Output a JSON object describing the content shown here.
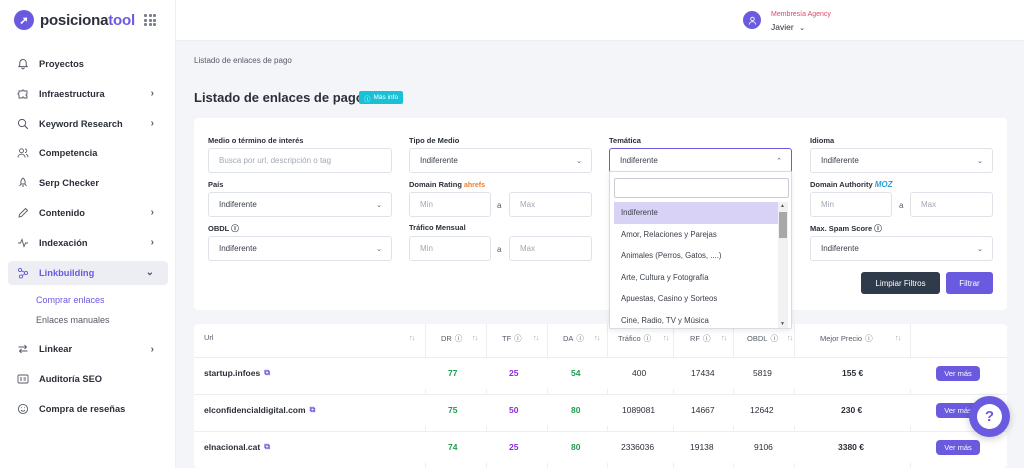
{
  "brand": {
    "name_prefix": "posiciona",
    "name_suffix": "tool",
    "accent": "#6a5ae0"
  },
  "user": {
    "role": "Membresía Agency",
    "name": "Javier"
  },
  "sidebar": {
    "items": [
      {
        "label": "Proyectos",
        "icon": "bell-icon"
      },
      {
        "label": "Infraestructura",
        "icon": "puzzle-icon"
      },
      {
        "label": "Keyword Research",
        "icon": "search-icon"
      },
      {
        "label": "Competencia",
        "icon": "users-icon"
      },
      {
        "label": "Serp Checker",
        "icon": "rocket-icon"
      },
      {
        "label": "Contenido",
        "icon": "pencil-icon"
      },
      {
        "label": "Indexación",
        "icon": "pulse-icon"
      },
      {
        "label": "Linkbuilding",
        "icon": "links-icon"
      },
      {
        "label": "Linkear",
        "icon": "arrows-icon"
      },
      {
        "label": "Auditoría SEO",
        "icon": "audit-icon"
      },
      {
        "label": "Compra de reseñas",
        "icon": "smile-icon"
      }
    ],
    "sub_items": [
      "Comprar enlaces",
      "Enlaces manuales"
    ]
  },
  "breadcrumb": "Listado de enlaces de pago",
  "page": {
    "title": "Listado de enlaces de pago",
    "info_badge": "Más info"
  },
  "filters": {
    "medio_label": "Medio o término de interés",
    "medio_placeholder": "Busca por url, descripción o tag",
    "tipo_label": "Tipo de Medio",
    "tipo_value": "Indiferente",
    "tematica_label": "Temática",
    "tematica_value": "Indiferente",
    "idioma_label": "Idioma",
    "idioma_value": "Indiferente",
    "pais_label": "País",
    "pais_value": "Indiferente",
    "dr_label": "Domain Rating",
    "dr_brand": "ahrefs",
    "da_label": "Domain Authority",
    "da_brand": "MOZ",
    "min_placeholder": "Min",
    "max_placeholder": "Max",
    "range_sep": "a",
    "obdl_label": "OBDL",
    "obdl_value": "Indiferente",
    "trafico_label": "Tráfico Mensual",
    "spam_label": "Max. Spam Score",
    "spam_value": "Indiferente",
    "clear_button": "Limpiar Filtros",
    "filter_button": "Filtrar"
  },
  "tematica_options": [
    "Indiferente",
    "Amor, Relaciones y Parejas",
    "Animales (Perros, Gatos, ....)",
    "Arte, Cultura y Fotografía",
    "Apuestas, Casino y Sorteos",
    "Cine, Radio, TV y Música"
  ],
  "table": {
    "headers": [
      "Url",
      "DR",
      "TF",
      "DA",
      "Tráfico",
      "RF",
      "OBDL",
      "Mejor Precio"
    ],
    "rows": [
      {
        "url": "startup.infoes",
        "dr": "77",
        "tf": "25",
        "da": "54",
        "trafico": "400",
        "rf": "17434",
        "obdl": "5819",
        "precio": "155 €"
      },
      {
        "url": "elconfidencialdigital.com",
        "dr": "75",
        "tf": "50",
        "da": "80",
        "trafico": "1089081",
        "rf": "14667",
        "obdl": "12642",
        "precio": "230 €"
      },
      {
        "url": "elnacional.cat",
        "dr": "74",
        "tf": "25",
        "da": "80",
        "trafico": "2336036",
        "rf": "19138",
        "obdl": "9106",
        "precio": "3380 €"
      }
    ],
    "action_label": "Ver más"
  }
}
